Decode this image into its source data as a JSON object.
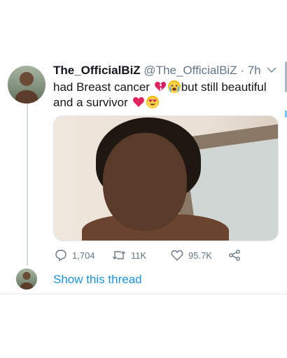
{
  "tweet": {
    "display_name": "The_OfficialBiZ",
    "handle": "@The_OfficialBiZ",
    "separator": "·",
    "time": "7h",
    "text_part1": "had Breast cancer",
    "text_part2": "but still beautiful and a survivor",
    "emojis": [
      "broken-heart",
      "crying-face",
      "red-heart",
      "heart-eyes-face"
    ]
  },
  "stats": {
    "replies": "1,704",
    "retweets": "11K",
    "likes": "95.7K"
  },
  "show_thread_label": "Show this thread",
  "colors": {
    "link": "#1b95e0",
    "muted": "#657786",
    "thread_line": "#cfd9de"
  }
}
